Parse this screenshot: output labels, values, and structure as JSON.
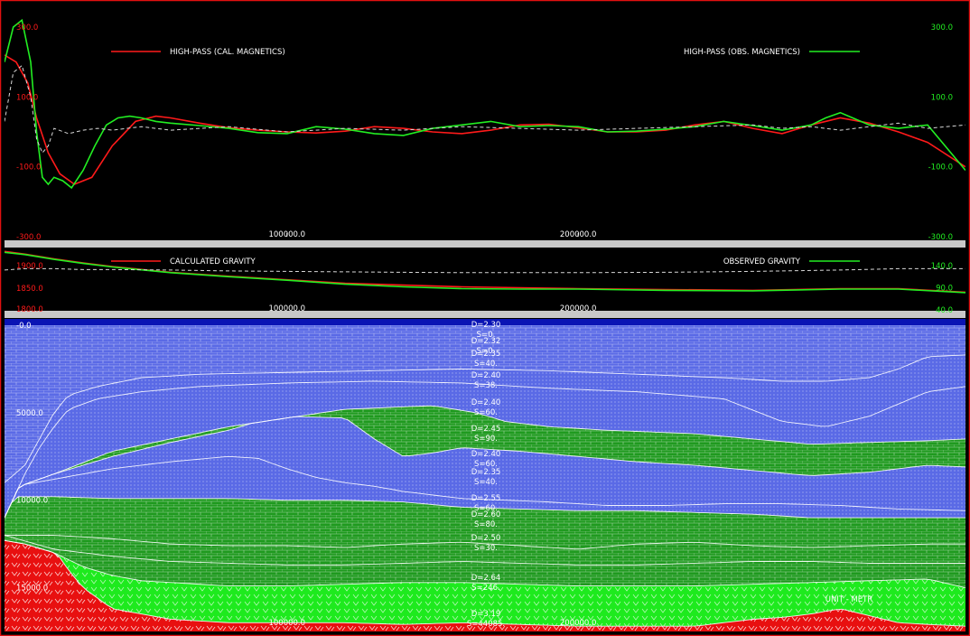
{
  "colors": {
    "frame": "#e01010",
    "calc": "#ff1a1a",
    "obs": "#22ee22",
    "dashed": "#d8d8d8",
    "water": "#0a14b4",
    "blue_unit": "#5a6ae6",
    "green_unit": "#1f9a1f",
    "bright_green": "#1eea1e",
    "basement": "#e81010",
    "label_white": "#ffffff",
    "separator": "#c8c8c8"
  },
  "chart_data": [
    {
      "type": "line",
      "name": "magnetics",
      "legend": {
        "calc_label": "HIGH-PASS (CAL. MAGNETICS)",
        "obs_label": "HIGH-PASS (OBS. MAGNETICS)"
      },
      "x_ticks": [
        "100000.0",
        "200000.0"
      ],
      "x_tick_values": [
        100000,
        200000
      ],
      "xlim": [
        3000,
        333000
      ],
      "left_ticks": [
        "300.0",
        "100.0",
        "-100.0",
        "-300.0"
      ],
      "right_ticks": [
        "300.0",
        "100.0",
        "-100.0",
        "-300.0"
      ],
      "ylim": [
        -300,
        300
      ],
      "series": [
        {
          "role": "calc",
          "x": [
            3000,
            7000,
            11000,
            14000,
            18000,
            22000,
            27000,
            33000,
            40000,
            48000,
            55000,
            60000,
            70000,
            80000,
            90000,
            100000,
            110000,
            120000,
            130000,
            140000,
            150000,
            160000,
            170000,
            180000,
            190000,
            200000,
            210000,
            220000,
            230000,
            240000,
            250000,
            260000,
            270000,
            280000,
            290000,
            300000,
            310000,
            320000,
            333000
          ],
          "y": [
            220,
            200,
            140,
            40,
            -60,
            -120,
            -150,
            -130,
            -40,
            30,
            45,
            40,
            25,
            12,
            5,
            0,
            -3,
            2,
            15,
            10,
            0,
            -5,
            5,
            20,
            22,
            12,
            0,
            0,
            5,
            20,
            30,
            10,
            -5,
            20,
            40,
            25,
            0,
            -30,
            -100
          ]
        },
        {
          "role": "obs",
          "x": [
            3000,
            6000,
            9000,
            12000,
            14000,
            16000,
            18000,
            20000,
            23000,
            26000,
            30000,
            34000,
            38000,
            42000,
            46000,
            50000,
            55000,
            60000,
            70000,
            80000,
            90000,
            100000,
            110000,
            120000,
            130000,
            140000,
            150000,
            160000,
            170000,
            180000,
            190000,
            200000,
            210000,
            220000,
            230000,
            240000,
            250000,
            260000,
            270000,
            280000,
            285000,
            290000,
            300000,
            310000,
            320000,
            333000
          ],
          "y": [
            200,
            300,
            320,
            200,
            0,
            -130,
            -150,
            -130,
            -140,
            -160,
            -110,
            -40,
            20,
            40,
            45,
            40,
            30,
            25,
            18,
            10,
            -2,
            -5,
            15,
            8,
            -5,
            -10,
            10,
            20,
            30,
            15,
            18,
            15,
            0,
            2,
            8,
            15,
            30,
            18,
            5,
            20,
            40,
            55,
            20,
            10,
            20,
            -110
          ]
        },
        {
          "role": "dashed",
          "x": [
            3000,
            6000,
            9000,
            12000,
            14000,
            16000,
            18000,
            20000,
            25000,
            30000,
            35000,
            40000,
            50000,
            60000,
            80000,
            100000,
            120000,
            140000,
            160000,
            180000,
            200000,
            220000,
            240000,
            260000,
            270000,
            280000,
            290000,
            300000,
            310000,
            320000,
            333000
          ],
          "y": [
            30,
            170,
            190,
            100,
            -20,
            -60,
            -40,
            10,
            -5,
            5,
            10,
            5,
            15,
            5,
            15,
            0,
            10,
            5,
            15,
            10,
            5,
            10,
            15,
            20,
            10,
            15,
            5,
            15,
            25,
            10,
            20
          ]
        }
      ]
    },
    {
      "type": "line",
      "name": "gravity",
      "legend": {
        "calc_label": "CALCULATED GRAVITY",
        "obs_label": "OBSERVED GRAVITY"
      },
      "x_ticks": [
        "100000.0",
        "200000.0"
      ],
      "x_tick_values": [
        100000,
        200000
      ],
      "xlim": [
        3000,
        333000
      ],
      "left_ticks": [
        "1900.0",
        "1850.0",
        "1800.0"
      ],
      "left_tick_values": [
        1900,
        1850,
        1800
      ],
      "right_ticks": [
        "140.0",
        "90.0",
        "40.0"
      ],
      "right_tick_values": [
        140,
        90,
        40
      ],
      "ylim": [
        40,
        140
      ],
      "series": [
        {
          "role": "calc",
          "x": [
            3000,
            10000,
            20000,
            30000,
            40000,
            60000,
            80000,
            100000,
            120000,
            140000,
            160000,
            180000,
            200000,
            230000,
            260000,
            290000,
            310000,
            333000
          ],
          "y": [
            172,
            166,
            155,
            146,
            138,
            125,
            116,
            108,
            100,
            96,
            92,
            90,
            88,
            86,
            84,
            88,
            88,
            80
          ]
        },
        {
          "role": "obs",
          "x": [
            3000,
            10000,
            20000,
            30000,
            40000,
            60000,
            80000,
            100000,
            120000,
            140000,
            160000,
            180000,
            200000,
            230000,
            260000,
            290000,
            310000,
            333000
          ],
          "y": [
            170,
            165,
            154,
            145,
            137,
            124,
            115,
            107,
            98,
            92,
            88,
            87,
            87,
            84,
            83,
            87,
            87,
            79
          ]
        },
        {
          "role": "dashed",
          "x": [
            3000,
            10000,
            20000,
            30000,
            40000,
            60000,
            80000,
            100000,
            120000,
            140000,
            160000,
            180000,
            200000,
            230000,
            260000,
            290000,
            310000,
            333000
          ],
          "y": [
            130,
            133,
            133,
            131,
            131,
            130,
            128,
            127,
            126,
            125,
            124,
            124,
            124,
            125,
            127,
            130,
            133,
            133
          ]
        }
      ]
    },
    {
      "type": "cross-section",
      "name": "geologic model",
      "x_ticks": [
        "100000.0",
        "200000.0"
      ],
      "x_tick_values": [
        100000,
        200000
      ],
      "xlim": [
        3000,
        333000
      ],
      "depth_ticks": [
        "-0.0",
        "5000.0",
        "10000.0",
        "15000.0"
      ],
      "depth_tick_values": [
        0,
        5000,
        10000,
        15000
      ],
      "depth_range": [
        0,
        17500
      ],
      "unit_note": "UNIT - METR",
      "unit_labels": [
        {
          "density": "D=2.30",
          "susceptibility": "S=0."
        },
        {
          "density": "D=2.32",
          "susceptibility": "S=0."
        },
        {
          "density": "D=2.35",
          "susceptibility": "S=40."
        },
        {
          "density": "D=2.40",
          "susceptibility": "S=38."
        },
        {
          "density": "D=2.40",
          "susceptibility": "S=60."
        },
        {
          "density": "D=2.45",
          "susceptibility": "S=90."
        },
        {
          "density": "D=2.40",
          "susceptibility": "S=60."
        },
        {
          "density": "D=2.35",
          "susceptibility": "S=40."
        },
        {
          "density": "D=2.55",
          "susceptibility": "S=60."
        },
        {
          "density": "D=2.60",
          "susceptibility": "S=80."
        },
        {
          "density": "D=2.50",
          "susceptibility": "S=30."
        },
        {
          "density": "D=2.64",
          "susceptibility": "S=246."
        },
        {
          "density": "D=3.19",
          "susceptibility": "S=44085."
        }
      ],
      "interfaces": [
        {
          "x": [
            3000,
            20000,
            40000,
            60000,
            80000,
            100000,
            120000,
            140000,
            160000,
            180000,
            200000,
            220000,
            240000,
            260000,
            280000,
            300000,
            320000,
            333000
          ],
          "y": [
            0,
            0,
            0,
            0,
            0,
            0,
            0,
            0,
            0,
            0,
            0,
            0,
            0,
            0,
            0,
            0,
            0,
            0
          ]
        },
        {
          "x": [
            3000,
            10000,
            15000,
            20000,
            25000,
            35000,
            50000,
            70000,
            100000,
            130000,
            160000,
            190000,
            220000,
            250000,
            270000,
            285000,
            300000,
            310000,
            320000,
            333000
          ],
          "y": [
            9000,
            8000,
            6500,
            5000,
            4000,
            3500,
            3000,
            2800,
            2700,
            2600,
            2500,
            2600,
            2800,
            3000,
            3200,
            3200,
            3000,
            2500,
            1800,
            1700
          ]
        },
        {
          "x": [
            3000,
            10000,
            15000,
            20000,
            25000,
            35000,
            50000,
            70000,
            100000,
            130000,
            160000,
            190000,
            220000,
            250000,
            270000,
            285000,
            300000,
            310000,
            320000,
            333000
          ],
          "y": [
            11000,
            8500,
            7000,
            5800,
            4800,
            4200,
            3800,
            3500,
            3300,
            3200,
            3300,
            3600,
            3800,
            4200,
            5500,
            5800,
            5200,
            4500,
            3800,
            3500
          ]
        },
        {
          "x": [
            3000,
            20000,
            40000,
            60000,
            80000,
            100000,
            120000,
            150000,
            165000,
            175000,
            190000,
            210000,
            240000,
            260000,
            280000,
            300000,
            320000,
            333000
          ],
          "y": [
            9500,
            8500,
            7200,
            6500,
            5800,
            5300,
            4800,
            4600,
            5000,
            5500,
            5800,
            6000,
            6200,
            6500,
            6800,
            6700,
            6600,
            6500
          ]
        },
        {
          "x": [
            3000,
            20000,
            40000,
            60000,
            80000,
            90000,
            100000,
            120000,
            130000,
            140000,
            150000,
            160000,
            180000,
            200000,
            220000,
            240000,
            260000,
            280000,
            300000,
            320000,
            333000
          ],
          "y": [
            9300,
            8500,
            7500,
            6700,
            6000,
            5500,
            5200,
            5300,
            6500,
            7500,
            7300,
            7000,
            7200,
            7500,
            7800,
            8000,
            8300,
            8600,
            8400,
            8000,
            8100
          ]
        },
        {
          "x": [
            3000,
            20000,
            40000,
            60000,
            80000,
            90000,
            100000,
            110000,
            120000,
            130000,
            140000,
            150000,
            160000,
            175000,
            190000,
            210000,
            230000,
            250000,
            270000,
            290000,
            310000,
            333000
          ],
          "y": [
            9300,
            8800,
            8200,
            7800,
            7500,
            7600,
            8200,
            8700,
            9000,
            9200,
            9500,
            9700,
            9900,
            10000,
            10100,
            10300,
            10300,
            10200,
            10200,
            10300,
            10500,
            10600
          ]
        },
        {
          "x": [
            3000,
            20000,
            40000,
            60000,
            80000,
            100000,
            120000,
            140000,
            160000,
            180000,
            200000,
            220000,
            240000,
            260000,
            280000,
            300000,
            320000,
            333000
          ],
          "y": [
            9800,
            9800,
            9900,
            9900,
            9900,
            10000,
            10000,
            10100,
            10400,
            10500,
            10600,
            10600,
            10700,
            10800,
            11000,
            11000,
            11000,
            11000
          ]
        },
        {
          "x": [
            3000,
            20000,
            40000,
            60000,
            80000,
            100000,
            120000,
            140000,
            160000,
            180000,
            200000,
            220000,
            240000,
            260000,
            280000,
            300000,
            320000,
            333000
          ],
          "y": [
            12000,
            12000,
            12200,
            12500,
            12600,
            12600,
            12700,
            12500,
            12400,
            12600,
            12800,
            12500,
            12400,
            12600,
            12700,
            12600,
            12500,
            12500
          ]
        },
        {
          "x": [
            3000,
            20000,
            40000,
            60000,
            80000,
            100000,
            120000,
            140000,
            160000,
            180000,
            200000,
            220000,
            240000,
            260000,
            280000,
            300000,
            320000,
            333000
          ],
          "y": [
            12000,
            12800,
            13200,
            13500,
            13600,
            13700,
            13700,
            13600,
            13500,
            13600,
            13700,
            13700,
            13600,
            13500,
            13500,
            13600,
            13600,
            13600
          ]
        },
        {
          "x": [
            3000,
            10000,
            20000,
            30000,
            40000,
            50000,
            60000,
            80000,
            100000,
            120000,
            140000,
            160000,
            180000,
            200000,
            220000,
            240000,
            260000,
            280000,
            300000,
            320000,
            333000
          ],
          "y": [
            12300,
            12500,
            13000,
            13800,
            14300,
            14600,
            14700,
            14900,
            14900,
            14800,
            14700,
            14700,
            14800,
            14900,
            14900,
            14900,
            14800,
            14700,
            14600,
            14500,
            15000
          ]
        },
        {
          "x": [
            3000,
            10000,
            20000,
            25000,
            30000,
            40000,
            60000,
            80000,
            100000,
            120000,
            140000,
            160000,
            180000,
            200000,
            220000,
            240000,
            250000,
            260000,
            270000,
            280000,
            290000,
            300000,
            310000,
            320000,
            333000
          ],
          "y": [
            12300,
            12200,
            12800,
            14000,
            15000,
            16200,
            16800,
            17000,
            17000,
            17000,
            17100,
            17000,
            17100,
            17200,
            17200,
            17200,
            17000,
            16800,
            16700,
            16500,
            16200,
            16600,
            17000,
            17100,
            17200
          ]
        }
      ],
      "unit_order": [
        "light-blue",
        "blue",
        "blue",
        "green",
        "blue",
        "blue",
        "green",
        "green",
        "green",
        "bright-green",
        "red"
      ]
    }
  ]
}
